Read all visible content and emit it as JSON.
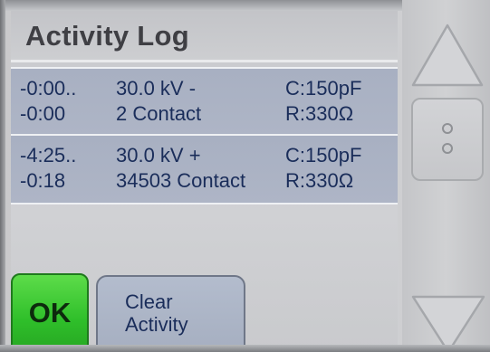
{
  "title": "Activity Log",
  "log_entries": [
    {
      "time_start": "-0:00..",
      "time_elapsed": "-0:00",
      "voltage": "30.0 kV -",
      "count": "2 Contact",
      "capacitance": "C:150pF",
      "resistance": "R:330Ω"
    },
    {
      "time_start": "-4:25..",
      "time_elapsed": "-0:18",
      "voltage": "30.0 kV +",
      "count": "34503 Contact",
      "capacitance": "C:150pF",
      "resistance": "R:330Ω"
    }
  ],
  "buttons": {
    "ok_label": "OK",
    "clear_line1": "Clear",
    "clear_line2": "Activity"
  },
  "scrollbar": {
    "up_icon": "triangle-up-icon",
    "down_icon": "triangle-down-icon",
    "thumb_icon": "grip-dots-icon"
  },
  "colors": {
    "ok_green": "#2fbf2a",
    "entry_background": "#aab2c4",
    "entry_text": "#1a2d5a",
    "title_text": "#3f3f44"
  }
}
